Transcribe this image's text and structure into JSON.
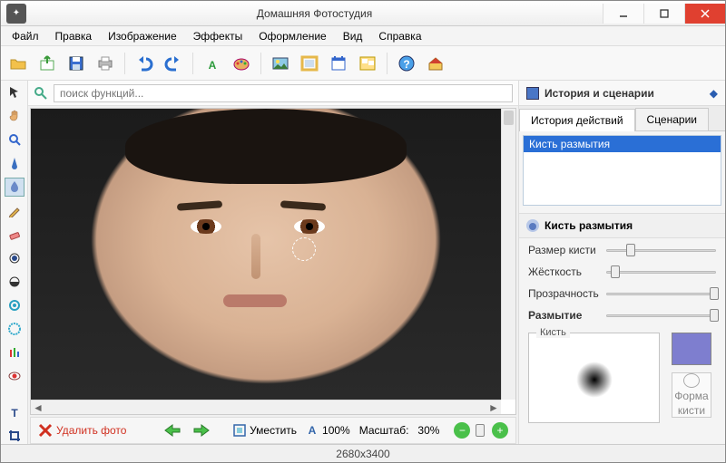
{
  "app": {
    "title": "Домашняя Фотостудия"
  },
  "menu": {
    "items": [
      "Файл",
      "Правка",
      "Изображение",
      "Эффекты",
      "Оформление",
      "Вид",
      "Справка"
    ]
  },
  "toolbar": {
    "icons": [
      "folder-open-icon",
      "export-icon",
      "save-icon",
      "print-icon",
      "undo-icon",
      "redo-icon",
      "text-icon",
      "palette-icon",
      "image-icon",
      "frame-icon",
      "calendar-icon",
      "collage-icon",
      "help-icon",
      "home-icon"
    ]
  },
  "search": {
    "placeholder": "поиск функций..."
  },
  "palette": {
    "tools": [
      "pointer-tool",
      "hand-tool",
      "zoom-tool",
      "sharpen-tool",
      "blur-tool",
      "pencil-tool",
      "eraser-tool",
      "dodge-tool",
      "burn-tool",
      "clone-tool",
      "denoise-tool",
      "levels-tool",
      "redeye-tool",
      "text-tool",
      "crop-tool"
    ],
    "active": "blur-tool"
  },
  "canvasbar": {
    "delete_label": "Удалить фото",
    "fit_label": "Уместить",
    "zoom100_label": "100%",
    "scale_label": "Масштаб:",
    "scale_value": "30%"
  },
  "rightpanel": {
    "header": "История и сценарии",
    "tabs": {
      "history": "История действий",
      "scenarios": "Сценарии",
      "active": "history"
    },
    "history_items": [
      "Кисть размытия"
    ],
    "tool_title": "Кисть размытия",
    "sliders": {
      "size": {
        "label": "Размер кисти",
        "pos": 22
      },
      "hardness": {
        "label": "Жёсткость",
        "pos": 8
      },
      "opacity": {
        "label": "Прозрачность",
        "pos": 98
      },
      "blur": {
        "label": "Размытие",
        "pos": 98,
        "bold": true
      }
    },
    "brush_group_label": "Кисть",
    "shape_btn_line1": "Форма",
    "shape_btn_line2": "кисти",
    "color": "#7e7ecf"
  },
  "status": {
    "dimensions": "2680x3400"
  }
}
